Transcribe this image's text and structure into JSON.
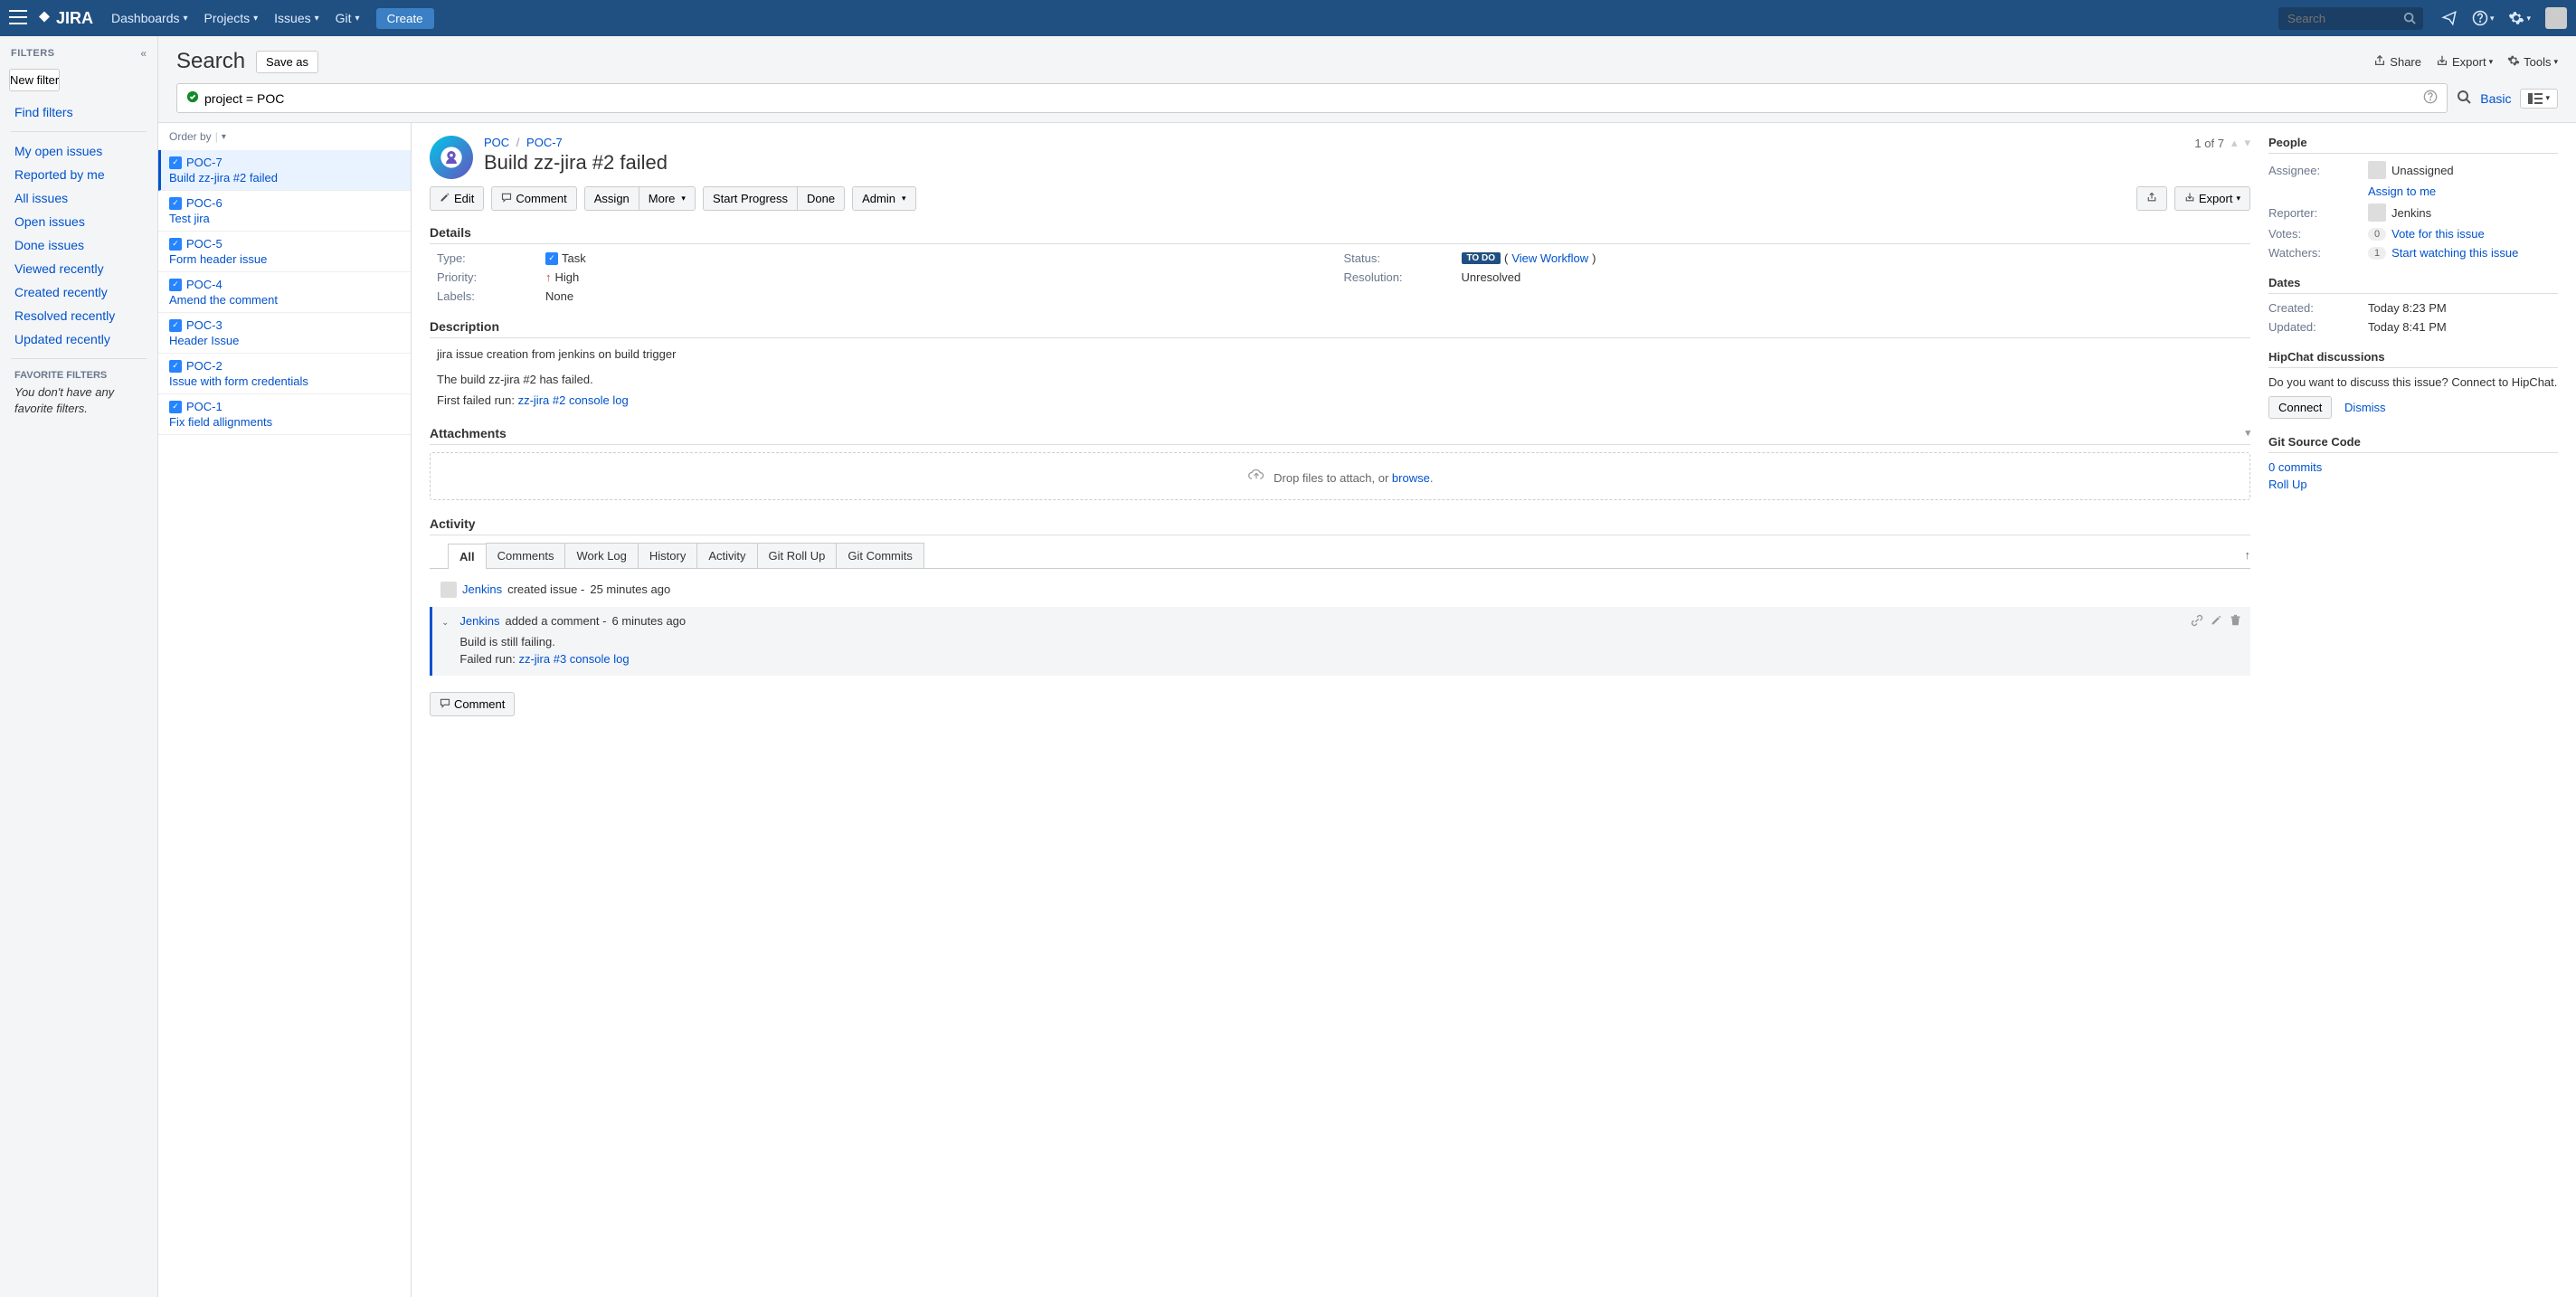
{
  "topnav": {
    "logo": "JIRA",
    "items": [
      "Dashboards",
      "Projects",
      "Issues",
      "Git"
    ],
    "create": "Create",
    "search_placeholder": "Search"
  },
  "sidebar": {
    "filters_label": "FILTERS",
    "new_filter": "New filter",
    "find_filters": "Find filters",
    "links": [
      "My open issues",
      "Reported by me",
      "All issues",
      "Open issues",
      "Done issues",
      "Viewed recently",
      "Created recently",
      "Resolved recently",
      "Updated recently"
    ],
    "fav_label": "FAVORITE FILTERS",
    "fav_empty": "You don't have any favorite filters."
  },
  "search": {
    "title": "Search",
    "save_as": "Save as",
    "share": "Share",
    "export": "Export",
    "tools": "Tools",
    "jql": "project = POC",
    "basic": "Basic",
    "order_by": "Order by"
  },
  "issues": [
    {
      "key": "POC-7",
      "summary": "Build zz-jira #2 failed",
      "selected": true
    },
    {
      "key": "POC-6",
      "summary": "Test jira"
    },
    {
      "key": "POC-5",
      "summary": "Form header issue"
    },
    {
      "key": "POC-4",
      "summary": "Amend the comment"
    },
    {
      "key": "POC-3",
      "summary": "Header Issue"
    },
    {
      "key": "POC-2",
      "summary": "Issue with form credentials"
    },
    {
      "key": "POC-1",
      "summary": "Fix field allignments"
    }
  ],
  "issue": {
    "breadcrumb": {
      "project": "POC",
      "key": "POC-7"
    },
    "title": "Build zz-jira #2 failed",
    "pagination": "1 of 7",
    "actions": {
      "edit": "Edit",
      "comment": "Comment",
      "assign": "Assign",
      "more": "More",
      "start": "Start Progress",
      "done": "Done",
      "admin": "Admin",
      "export": "Export"
    },
    "details": {
      "header": "Details",
      "type_label": "Type:",
      "type_value": "Task",
      "status_label": "Status:",
      "status_value": "TO DO",
      "view_workflow": "View Workflow",
      "priority_label": "Priority:",
      "priority_value": "High",
      "resolution_label": "Resolution:",
      "resolution_value": "Unresolved",
      "labels_label": "Labels:",
      "labels_value": "None"
    },
    "description": {
      "header": "Description",
      "line1": "jira issue creation from jenkins on build trigger",
      "line2": "The build zz-jira #2 has failed.",
      "line3_prefix": "First failed run: ",
      "line3_link": "zz-jira #2 console log"
    },
    "attachments": {
      "header": "Attachments",
      "drop_text": "Drop files to attach, or ",
      "browse": "browse"
    },
    "activity": {
      "header": "Activity",
      "tabs": [
        "All",
        "Comments",
        "Work Log",
        "History",
        "Activity",
        "Git Roll Up",
        "Git Commits"
      ],
      "entry1": {
        "author": "Jenkins",
        "action": " created issue - ",
        "time": "25 minutes ago"
      },
      "comment": {
        "author": "Jenkins",
        "action": " added a comment - ",
        "time": "6 minutes ago",
        "body_line1": "Build is still failing.",
        "body_line2_prefix": "Failed run: ",
        "body_line2_link": "zz-jira #3 console log"
      },
      "comment_button": "Comment"
    }
  },
  "people": {
    "header": "People",
    "assignee_label": "Assignee:",
    "assignee_value": "Unassigned",
    "assign_to_me": "Assign to me",
    "reporter_label": "Reporter:",
    "reporter_value": "Jenkins",
    "votes_label": "Votes:",
    "votes_count": "0",
    "vote_link": "Vote for this issue",
    "watchers_label": "Watchers:",
    "watchers_count": "1",
    "watch_link": "Start watching this issue"
  },
  "dates": {
    "header": "Dates",
    "created_label": "Created:",
    "created_value": "Today 8:23 PM",
    "updated_label": "Updated:",
    "updated_value": "Today 8:41 PM"
  },
  "hipchat": {
    "header": "HipChat discussions",
    "text": "Do you want to discuss this issue? Connect to HipChat.",
    "connect": "Connect",
    "dismiss": "Dismiss"
  },
  "git": {
    "header": "Git Source Code",
    "commits": "0 commits",
    "rollup": "Roll Up"
  }
}
